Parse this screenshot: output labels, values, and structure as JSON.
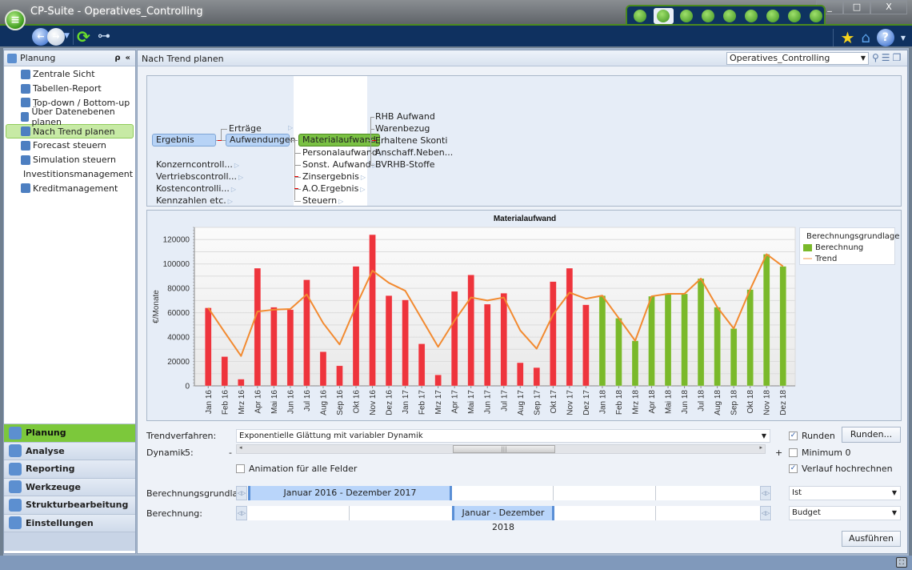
{
  "window": {
    "title": "CP-Suite - Operatives_Controlling",
    "buttons": {
      "minimize": "_",
      "maximize": "□",
      "close": "X"
    }
  },
  "module_tabs": [
    {
      "icon": "dashboard-gauge-icon"
    },
    {
      "icon": "planning-gears-icon",
      "active": true
    },
    {
      "icon": "leaf-icon"
    },
    {
      "icon": "money-icon"
    },
    {
      "icon": "globe-icon"
    },
    {
      "icon": "lifebuoy-icon"
    },
    {
      "icon": "gears-icon"
    },
    {
      "icon": "compass-icon"
    },
    {
      "icon": "users-building-icon"
    }
  ],
  "nav": {
    "back": "back-icon",
    "forward": "forward-icon",
    "refresh": "refresh-icon",
    "tree": "tree-structure-icon"
  },
  "sidebar": {
    "title": "Planung",
    "search_icon": "ρ",
    "collapse_icon": "«",
    "items": [
      {
        "label": "Zentrale Sicht"
      },
      {
        "label": "Tabellen-Report"
      },
      {
        "label": "Top-down / Bottom-up"
      },
      {
        "label": "Über Datenebenen planen"
      },
      {
        "label": "Nach Trend planen",
        "active": true
      },
      {
        "label": "Forecast steuern"
      },
      {
        "label": "Simulation steuern"
      },
      {
        "label": "Investitionsmanagement"
      },
      {
        "label": "Kreditmanagement"
      }
    ],
    "sections": [
      {
        "label": "Planung",
        "active": true
      },
      {
        "label": "Analyse"
      },
      {
        "label": "Reporting"
      },
      {
        "label": "Werkzeuge"
      },
      {
        "label": "Strukturbearbeitung"
      },
      {
        "label": "Einstellungen"
      }
    ]
  },
  "content": {
    "title": "Nach Trend planen",
    "model_combo": "Operatives_Controlling",
    "tree": {
      "col1": [
        "Ergebnis",
        "Konzerncontroll...",
        "Vertriebscontroll...",
        "Kostencontrolli...",
        "Kennzahlen etc."
      ],
      "col2": [
        "Erträge",
        "Aufwendungen"
      ],
      "col3": [
        "Materialaufwand",
        "Personalaufwand",
        "Sonst. Aufwand",
        "Zinsergebnis",
        "A.O.Ergebnis",
        "Steuern"
      ],
      "col4": [
        "RHB Aufwand",
        "Warenbezug",
        "Erhaltene Skonti",
        "Anschaff.Neben...",
        "BVRHB-Stoffe"
      ]
    },
    "controls": {
      "trend_label": "Trendverfahren:",
      "trend_value": "Exponentielle Glättung mit variabler Dynamik",
      "dynamik_label": "Dynamik",
      "dynamik_value": "5:",
      "minus": "-",
      "plus": "+",
      "animation_label": "Animation für alle Felder",
      "animation_checked": false,
      "runden_label": "Runden",
      "runden_checked": true,
      "runden_button": "Runden...",
      "minimum_label": "Minimum 0",
      "minimum_checked": false,
      "verlauf_label": "Verlauf hochrechnen",
      "verlauf_checked": true,
      "basis_label": "Berechnungsgrundlage:",
      "basis_range": "Januar 2016 - Dezember 2017",
      "basis_type": "Ist",
      "calc_label": "Berechnung:",
      "calc_range": "Januar - Dezember 2018",
      "calc_type": "Budget",
      "execute_button": "Ausführen",
      "slider_position": 0.5
    }
  },
  "chart_data": {
    "type": "bar",
    "title": "Materialaufwand",
    "xlabel": "",
    "ylabel": "€/Monate",
    "ylim": [
      0,
      130000
    ],
    "yticks": [
      0,
      20000,
      40000,
      60000,
      80000,
      100000,
      120000
    ],
    "grid": true,
    "legend_position": "top-right",
    "categories": [
      "Jan 16",
      "Feb 16",
      "Mrz 16",
      "Apr 16",
      "Mai 16",
      "Jun 16",
      "Jul 16",
      "Aug 16",
      "Sep 16",
      "Okt 16",
      "Nov 16",
      "Dez 16",
      "Jan 17",
      "Feb 17",
      "Mrz 17",
      "Apr 17",
      "Mai 17",
      "Jun 17",
      "Jul 17",
      "Aug 17",
      "Sep 17",
      "Okt 17",
      "Nov 17",
      "Dez 17",
      "Jan 18",
      "Feb 18",
      "Mrz 18",
      "Apr 18",
      "Mai 18",
      "Jun 18",
      "Jul 18",
      "Aug 18",
      "Sep 18",
      "Okt 18",
      "Nov 18",
      "Dez 18"
    ],
    "series": [
      {
        "name": "Berechnungsgrundlage",
        "type": "bar",
        "color": "#ee343c",
        "values": [
          64000,
          24000,
          5500,
          96500,
          64500,
          62500,
          87000,
          28000,
          16500,
          98000,
          124000,
          74000,
          70500,
          34500,
          9000,
          77500,
          91000,
          67000,
          76000,
          19000,
          15000,
          85500,
          96500,
          66500,
          null,
          null,
          null,
          null,
          null,
          null,
          null,
          null,
          null,
          null,
          null,
          null
        ]
      },
      {
        "name": "Berechnung",
        "type": "bar",
        "color": "#7ab92a",
        "values": [
          null,
          null,
          null,
          null,
          null,
          null,
          null,
          null,
          null,
          null,
          null,
          null,
          null,
          null,
          null,
          null,
          null,
          null,
          null,
          null,
          null,
          null,
          null,
          null,
          74000,
          55500,
          37000,
          73500,
          75500,
          75500,
          88000,
          64500,
          47000,
          79000,
          108000,
          98000
        ]
      },
      {
        "name": "Trend",
        "type": "line",
        "color": "#f28a30",
        "values": [
          64000,
          44000,
          24500,
          61000,
          62500,
          63000,
          75000,
          51500,
          34000,
          65500,
          94500,
          84500,
          78000,
          55000,
          32000,
          53500,
          72500,
          70000,
          72500,
          45500,
          30500,
          58500,
          76500,
          71500,
          74000,
          55500,
          37000,
          73500,
          75500,
          75500,
          88000,
          64500,
          47000,
          79000,
          108000,
          98000
        ]
      }
    ]
  }
}
